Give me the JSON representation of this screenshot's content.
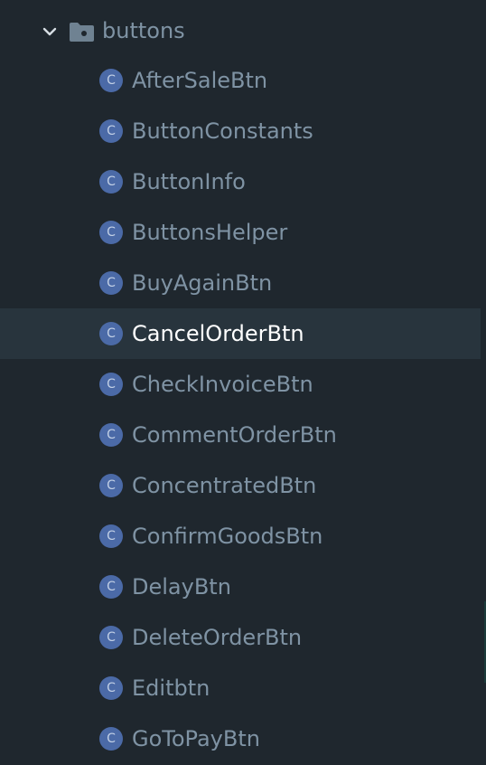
{
  "folder": {
    "label": "buttons",
    "icon": "folder-icon",
    "expanded_icon": "chevron-down-icon"
  },
  "items": [
    {
      "label": "AfterSaleBtn",
      "icon": "class-icon",
      "icon_letter": "C",
      "selected": false
    },
    {
      "label": "ButtonConstants",
      "icon": "class-icon",
      "icon_letter": "C",
      "selected": false
    },
    {
      "label": "ButtonInfo",
      "icon": "class-icon",
      "icon_letter": "C",
      "selected": false
    },
    {
      "label": "ButtonsHelper",
      "icon": "class-icon",
      "icon_letter": "C",
      "selected": false
    },
    {
      "label": "BuyAgainBtn",
      "icon": "class-icon",
      "icon_letter": "C",
      "selected": false
    },
    {
      "label": "CancelOrderBtn",
      "icon": "class-icon",
      "icon_letter": "C",
      "selected": true
    },
    {
      "label": "CheckInvoiceBtn",
      "icon": "class-icon",
      "icon_letter": "C",
      "selected": false
    },
    {
      "label": "CommentOrderBtn",
      "icon": "class-icon",
      "icon_letter": "C",
      "selected": false
    },
    {
      "label": "ConcentratedBtn",
      "icon": "class-icon",
      "icon_letter": "C",
      "selected": false
    },
    {
      "label": "ConfirmGoodsBtn",
      "icon": "class-icon",
      "icon_letter": "C",
      "selected": false
    },
    {
      "label": "DelayBtn",
      "icon": "class-icon",
      "icon_letter": "C",
      "selected": false
    },
    {
      "label": "DeleteOrderBtn",
      "icon": "class-icon",
      "icon_letter": "C",
      "selected": false
    },
    {
      "label": "Editbtn",
      "icon": "class-icon",
      "icon_letter": "C",
      "selected": false
    },
    {
      "label": "GoToPayBtn",
      "icon": "class-icon",
      "icon_letter": "C",
      "selected": false
    }
  ],
  "colors": {
    "background": "#1f272e",
    "selected_row": "#28343d",
    "text": "#7f93a4",
    "selected_text": "#ffffff",
    "class_icon_bg": "#4b6aa7",
    "class_icon_fg": "#c2d0e6"
  }
}
